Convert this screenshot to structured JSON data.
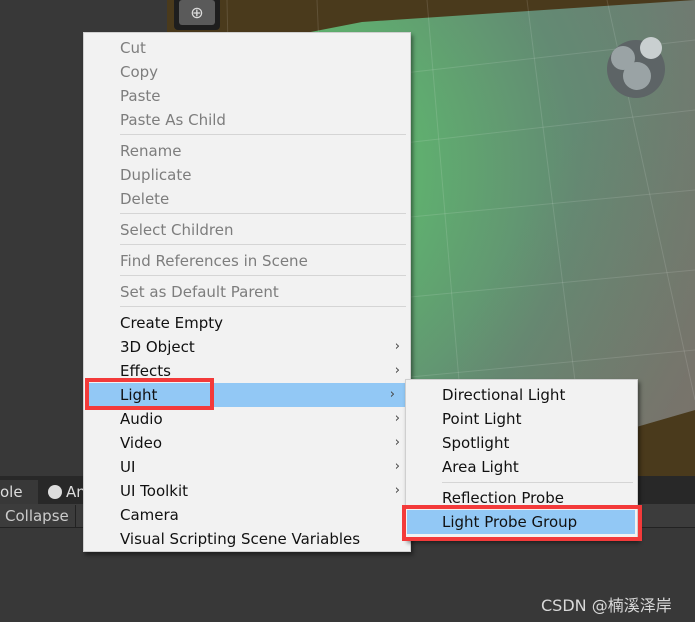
{
  "context_menu": {
    "items": [
      {
        "label": "Cut",
        "enabled": false
      },
      {
        "label": "Copy",
        "enabled": false
      },
      {
        "label": "Paste",
        "enabled": false
      },
      {
        "label": "Paste As Child",
        "enabled": false
      },
      {
        "label": "Rename",
        "enabled": false
      },
      {
        "label": "Duplicate",
        "enabled": false
      },
      {
        "label": "Delete",
        "enabled": false
      },
      {
        "label": "Select Children",
        "enabled": false
      },
      {
        "label": "Find References in Scene",
        "enabled": false
      },
      {
        "label": "Set as Default Parent",
        "enabled": false
      },
      {
        "label": "Create Empty",
        "enabled": true
      },
      {
        "label": "3D Object",
        "enabled": true,
        "submenu": true
      },
      {
        "label": "Effects",
        "enabled": true,
        "submenu": true
      },
      {
        "label": "Light",
        "enabled": true,
        "submenu": true,
        "highlighted": true
      },
      {
        "label": "Audio",
        "enabled": true,
        "submenu": true
      },
      {
        "label": "Video",
        "enabled": true,
        "submenu": true
      },
      {
        "label": "UI",
        "enabled": true,
        "submenu": true
      },
      {
        "label": "UI Toolkit",
        "enabled": true,
        "submenu": true
      },
      {
        "label": "Camera",
        "enabled": true
      },
      {
        "label": "Visual Scripting Scene Variables",
        "enabled": true
      }
    ]
  },
  "light_submenu": {
    "items": [
      {
        "label": "Directional Light"
      },
      {
        "label": "Point Light"
      },
      {
        "label": "Spotlight"
      },
      {
        "label": "Area Light"
      },
      {
        "label": "Reflection Probe"
      },
      {
        "label": "Light Probe Group",
        "highlighted": true
      }
    ]
  },
  "bottom_panel": {
    "tabs": [
      {
        "label": "ole"
      },
      {
        "label": "An",
        "icon": "clock-icon"
      }
    ],
    "collapse_label": "Collapse"
  },
  "watermark": "CSDN @楠溪泽岸",
  "colors": {
    "highlight": "#92c8f5",
    "annotation_red": "#f33a3a",
    "menu_bg": "#f2f2f2"
  }
}
